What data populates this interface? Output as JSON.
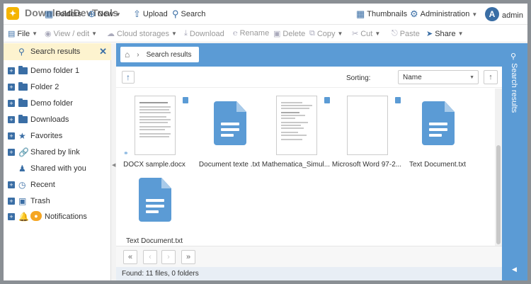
{
  "app": {
    "watermark": "DownloadDevTools"
  },
  "topbar": {
    "folders": "Folders",
    "new": "New",
    "upload": "Upload",
    "search": "Search",
    "thumbnails": "Thumbnails",
    "administration": "Administration",
    "avatar_letter": "A",
    "user": "admin"
  },
  "toolbar": {
    "file": "File",
    "view_edit": "View / edit",
    "cloud_storages": "Cloud storages",
    "download": "Download",
    "rename": "Rename",
    "delete": "Delete",
    "copy": "Copy",
    "cut": "Cut",
    "paste": "Paste",
    "share": "Share"
  },
  "sidebar": {
    "search_results": "Search results",
    "items": [
      {
        "label": "Demo folder 1",
        "icon": "folder-icon",
        "expandable": true
      },
      {
        "label": "Folder 2",
        "icon": "folder-icon",
        "expandable": true
      },
      {
        "label": "Demo folder",
        "icon": "folder-icon",
        "expandable": true
      },
      {
        "label": "Downloads",
        "icon": "folder-icon",
        "expandable": true
      },
      {
        "label": "Favorites",
        "icon": "star-icon",
        "expandable": true
      },
      {
        "label": "Shared by link",
        "icon": "link-icon",
        "expandable": true
      },
      {
        "label": "Shared with you",
        "icon": "users-icon",
        "expandable": false
      },
      {
        "label": "Recent",
        "icon": "clock-icon",
        "expandable": true
      },
      {
        "label": "Trash",
        "icon": "trash-icon",
        "expandable": true
      },
      {
        "label": "Notifications",
        "icon": "bell-icon",
        "expandable": true
      }
    ]
  },
  "breadcrumb": {
    "current": "Search results"
  },
  "sorting": {
    "label": "Sorting:",
    "selected": "Name"
  },
  "files": [
    {
      "name": "DOCX sample.docx",
      "kind": "thumbnail"
    },
    {
      "name": "Document texte .txt",
      "kind": "doc"
    },
    {
      "name": "Mathematica_Simul...",
      "kind": "thumbnail"
    },
    {
      "name": "Microsoft Word 97-2...",
      "kind": "blank"
    },
    {
      "name": "Text Document.txt",
      "kind": "doc"
    },
    {
      "name": "Text Document.txt",
      "kind": "doc"
    }
  ],
  "status": {
    "text": "Found: 11 files, 0 folders"
  },
  "right_panel": {
    "title": "Search results"
  },
  "colors": {
    "accent": "#5b9bd5",
    "brand": "#3a6ea5",
    "highlight": "#fdf3cf"
  }
}
